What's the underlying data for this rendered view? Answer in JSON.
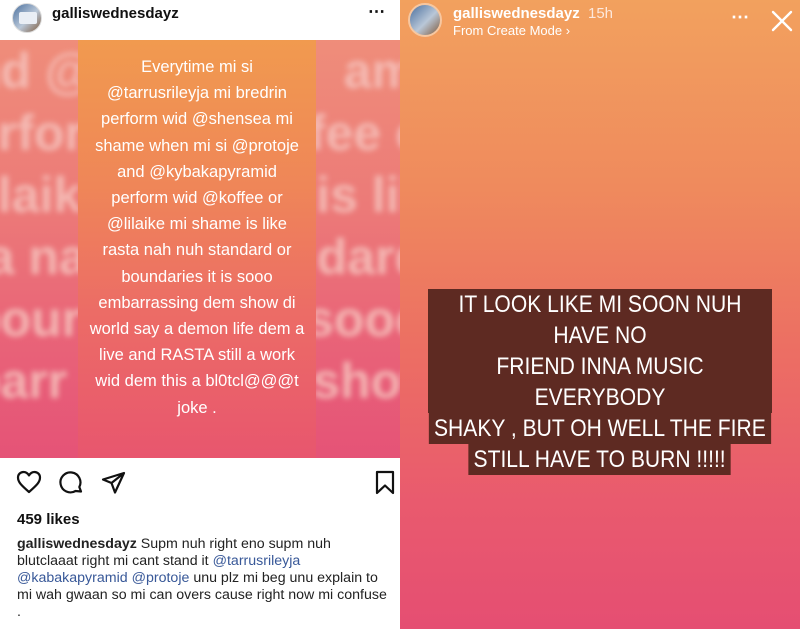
{
  "post": {
    "username": "galliswednesdayz",
    "more_icon": "⋯",
    "background_words": [
      "nd @",
      "amic",
      "erfor",
      "fee o",
      "lilaik",
      "is lik",
      "ta na",
      "dard",
      "bour",
      "sooo",
      "barr",
      "show"
    ],
    "image_text": "Everytime mi si\n@tarrusrileyja mi bredrin\nperform wid @shensea mi\nshame when mi si @protoje\nand @kybakapyramid\nperform wid @koffee or\n@lilaike mi shame is like\nrasta nah nuh standard or\nboundaries it is sooo\nembarrassing dem show di\nworld say a demon life dem a\nlive and RASTA still a work\nwid dem this a bl0tcl@@@t\njoke .",
    "likes": "459 likes",
    "caption": {
      "username": "galliswednesdayz",
      "text_1": " Supm nuh right eno supm nuh blutclaaat right mi cant stand it ",
      "tag_1": "@tarrusrileyja",
      "tag_2": "@kabakapyramid",
      "tag_3": "@protoje",
      "text_2": " unu plz mi beg unu explain to mi wah gwaan so mi can overs cause right now mi confuse ."
    },
    "icons": {
      "like": "heart-icon",
      "comment": "comment-icon",
      "share": "share-icon",
      "save": "bookmark-icon"
    }
  },
  "story": {
    "username": "galliswednesdayz",
    "time": "15h",
    "subtitle": "From Create Mode ›",
    "more_icon": "⋯",
    "lines": [
      "IT LOOK LIKE MI SOON NUH HAVE NO",
      "FRIEND INNA MUSIC EVERYBODY",
      "SHAKY , BUT OH WELL THE FIRE",
      "STILL HAVE TO BURN !!!!!"
    ],
    "colors": {
      "gradient_top": "#f2a15e",
      "gradient_bottom": "#e54e72",
      "text_background": "#5e2a22"
    }
  }
}
